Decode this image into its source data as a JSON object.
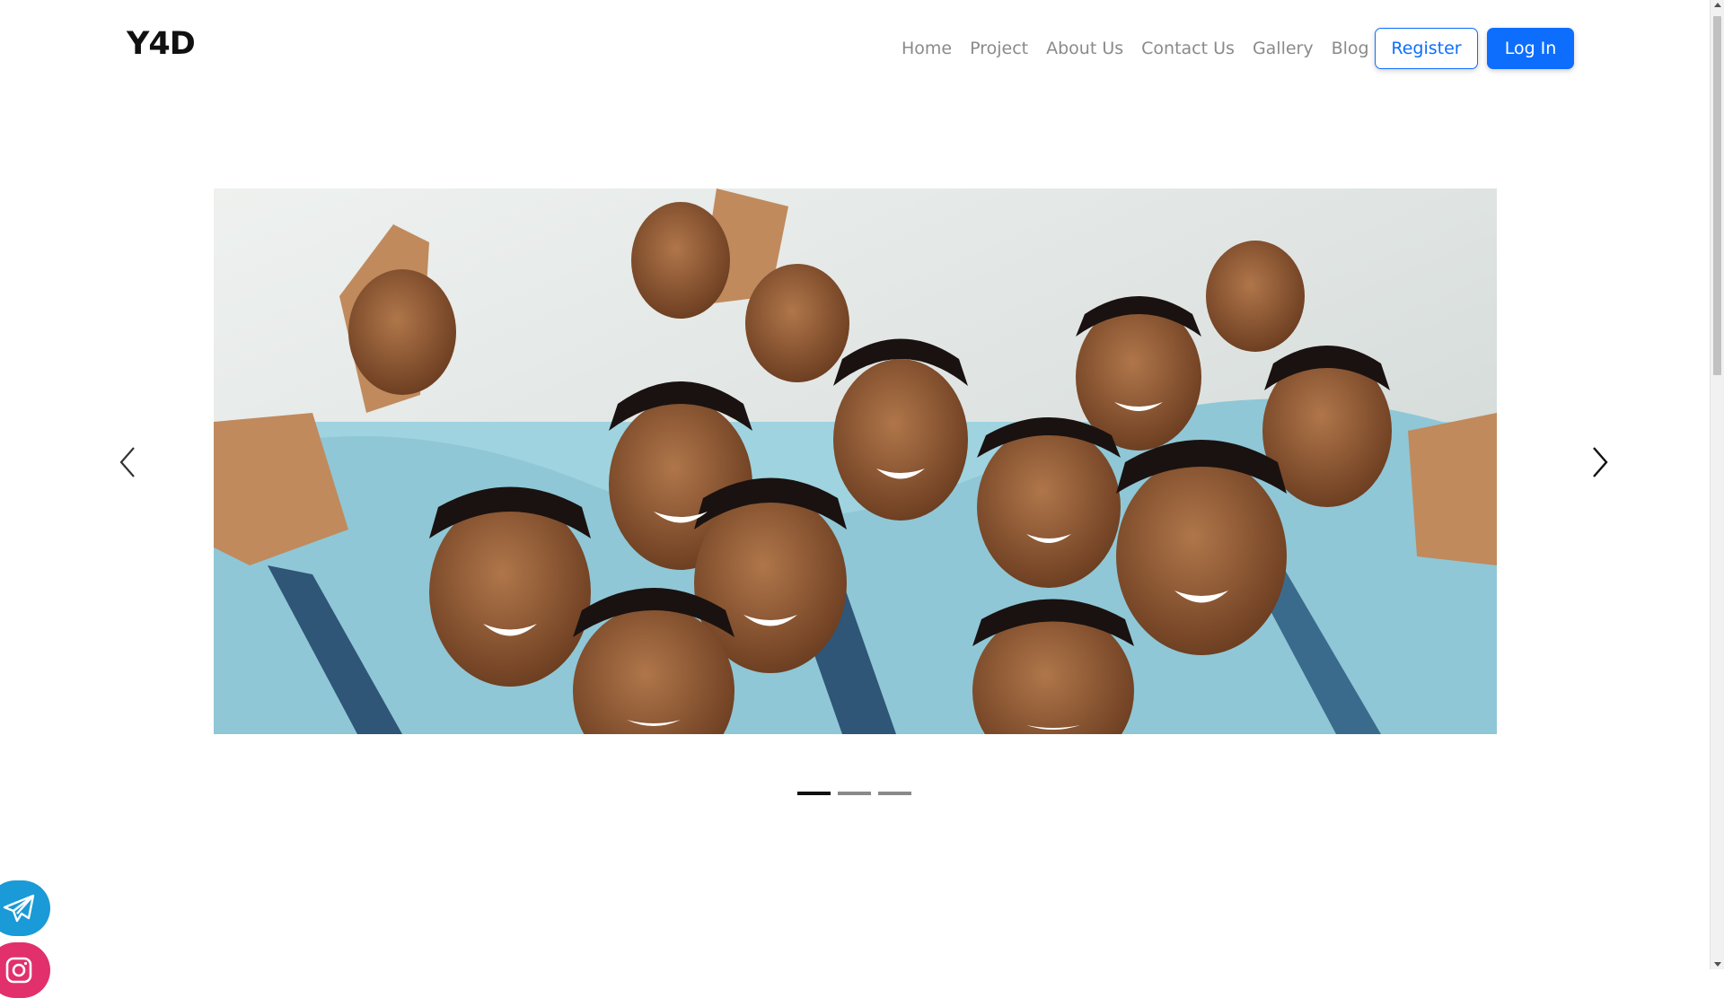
{
  "header": {
    "logo": "Y4D",
    "nav": [
      {
        "label": "Home",
        "name": "nav-home"
      },
      {
        "label": "Project",
        "name": "nav-project"
      },
      {
        "label": "About Us",
        "name": "nav-about-us"
      },
      {
        "label": "Contact Us",
        "name": "nav-contact-us"
      },
      {
        "label": "Gallery",
        "name": "nav-gallery"
      },
      {
        "label": "Blog",
        "name": "nav-blog"
      }
    ],
    "register_label": "Register",
    "login_label": "Log In"
  },
  "carousel": {
    "slide_count": 3,
    "active_index": 0,
    "image_subject": "group-of-smiling-schoolboys-in-uniform"
  },
  "floating_socials": [
    {
      "icon": "telegram-icon",
      "color": "#1a9ad6"
    },
    {
      "icon": "instagram-icon",
      "color": "#e1306c"
    }
  ],
  "colors": {
    "brand": "#0d6efd",
    "nav_text": "#8a8a8a",
    "logo_text": "#111111"
  }
}
